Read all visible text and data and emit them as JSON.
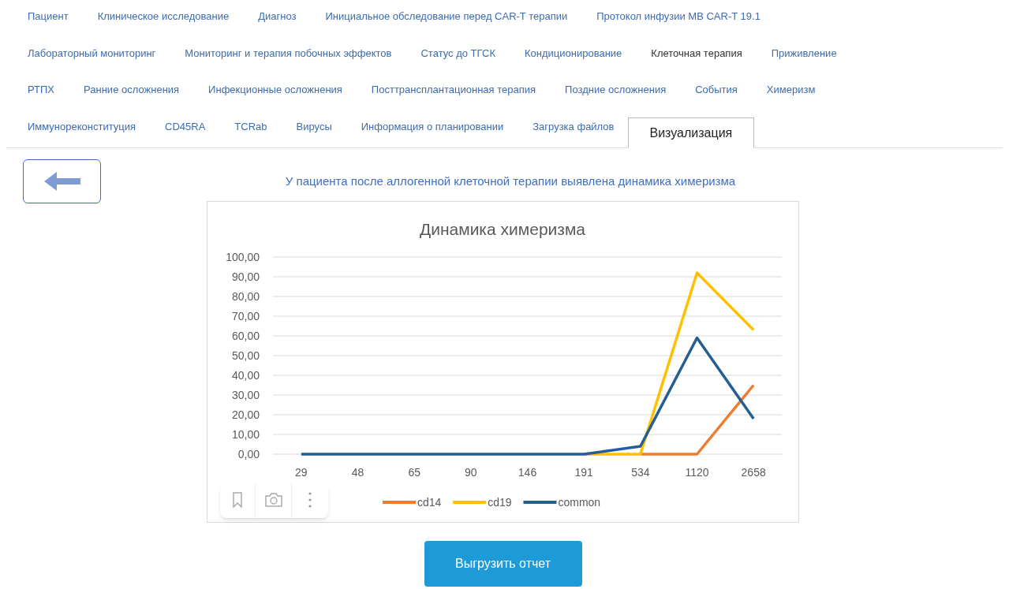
{
  "tab_rows": [
    [
      {
        "label": "Пациент",
        "selected": false,
        "hovered": false
      },
      {
        "label": "Клиническое исследование",
        "selected": false,
        "hovered": false
      },
      {
        "label": "Диагноз",
        "selected": false,
        "hovered": false
      },
      {
        "label": "Инициальное обследование перед CAR-T терапии",
        "selected": false,
        "hovered": false
      },
      {
        "label": "Протокол инфузии MB CAR-T 19.1",
        "selected": false,
        "hovered": false
      }
    ],
    [
      {
        "label": "Лабораторный мониторинг",
        "selected": false,
        "hovered": false
      },
      {
        "label": "Мониторинг и терапия побочных эффектов",
        "selected": false,
        "hovered": false
      },
      {
        "label": "Статус до ТГСК",
        "selected": false,
        "hovered": false
      },
      {
        "label": "Кондиционирование",
        "selected": false,
        "hovered": false
      },
      {
        "label": "Клеточная терапия",
        "selected": false,
        "hovered": true
      },
      {
        "label": "Приживление",
        "selected": false,
        "hovered": false
      }
    ],
    [
      {
        "label": "РТПХ",
        "selected": false,
        "hovered": false
      },
      {
        "label": "Ранние осложнения",
        "selected": false,
        "hovered": false
      },
      {
        "label": "Инфекционные осложнения",
        "selected": false,
        "hovered": false
      },
      {
        "label": "Посттрансплантационная терапия",
        "selected": false,
        "hovered": false
      },
      {
        "label": "Поздние осложнения",
        "selected": false,
        "hovered": false
      },
      {
        "label": "События",
        "selected": false,
        "hovered": false
      },
      {
        "label": "Химеризм",
        "selected": false,
        "hovered": false
      }
    ],
    [
      {
        "label": "Иммунореконституция",
        "selected": false,
        "hovered": false
      },
      {
        "label": "CD45RA",
        "selected": false,
        "hovered": false
      },
      {
        "label": "TCRab",
        "selected": false,
        "hovered": false
      },
      {
        "label": "Вирусы",
        "selected": false,
        "hovered": false
      },
      {
        "label": "Информация о планировании",
        "selected": false,
        "hovered": false
      },
      {
        "label": "Загрузка файлов",
        "selected": false,
        "hovered": false
      },
      {
        "label": "Визуализация",
        "selected": true,
        "hovered": false
      }
    ]
  ],
  "message": "У пациента после аллогенной клеточной терапии выявлена динамика химеризма",
  "chart": {
    "chart_data": {
      "type": "line",
      "title": "Динамика химеризма",
      "categories": [
        "29",
        "48",
        "65",
        "90",
        "146",
        "191",
        "534",
        "1120",
        "2658"
      ],
      "series": [
        {
          "name": "cd14",
          "color": "#ed7d31",
          "values": [
            null,
            null,
            null,
            null,
            null,
            null,
            0,
            0,
            35
          ]
        },
        {
          "name": "cd19",
          "color": "#ffc000",
          "values": [
            null,
            null,
            null,
            null,
            null,
            0,
            0,
            92,
            63
          ]
        },
        {
          "name": "common",
          "color": "#255e91",
          "values": [
            0,
            0,
            0,
            0,
            0,
            0,
            4,
            59,
            18
          ]
        }
      ],
      "ylim": [
        0,
        100
      ],
      "grid": true,
      "legend": "bottom",
      "yticks": [
        {
          "value": 0,
          "label": "0,00"
        },
        {
          "value": 10,
          "label": "10,00"
        },
        {
          "value": 20,
          "label": "20,00"
        },
        {
          "value": 30,
          "label": "30,00"
        },
        {
          "value": 40,
          "label": "40,00"
        },
        {
          "value": 50,
          "label": "50,00"
        },
        {
          "value": 60,
          "label": "60,00"
        },
        {
          "value": 70,
          "label": "70,00"
        },
        {
          "value": 80,
          "label": "80,00"
        },
        {
          "value": 90,
          "label": "90,00"
        },
        {
          "value": 100,
          "label": "100,00"
        }
      ]
    }
  },
  "export_button": "Выгрузить отчет"
}
